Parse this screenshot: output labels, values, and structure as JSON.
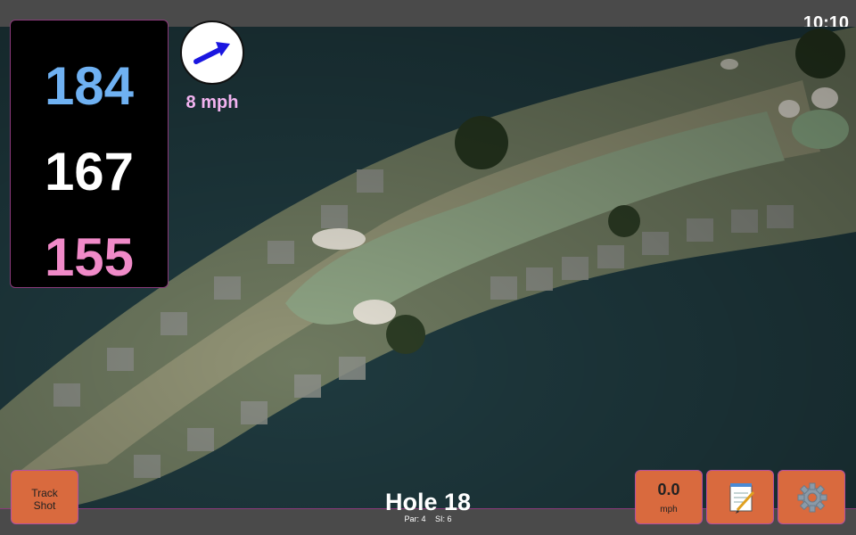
{
  "status": {
    "time": "10:10"
  },
  "distances": {
    "back": "184",
    "middle": "167",
    "front": "155"
  },
  "wind": {
    "speed": "8 mph",
    "direction_deg": 70
  },
  "buttons": {
    "track_shot_line1": "Track",
    "track_shot_line2": "Shot",
    "speed_value": "0.0",
    "speed_unit": "mph",
    "scorecard_icon": "notepad-icon",
    "settings_icon": "gear-icon"
  },
  "hole": {
    "title": "Hole 18",
    "par": "Par: 4",
    "si": "SI: 6"
  },
  "colors": {
    "back": "#6fb1f2",
    "middle": "#ffffff",
    "front": "#f08ac8",
    "wind_text": "#f2b3f0",
    "button_bg": "#d96a3e",
    "accent_border": "#8a3a7a",
    "wind_arrow": "#1a16e0"
  }
}
